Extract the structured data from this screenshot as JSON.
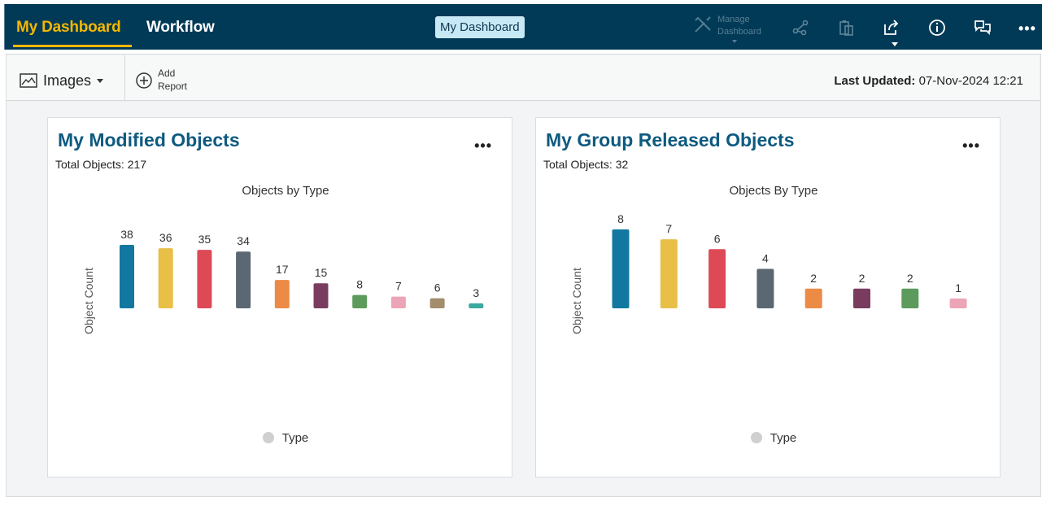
{
  "header": {
    "tabs": [
      {
        "label": "My Dashboard",
        "active": true
      },
      {
        "label": "Workflow",
        "active": false
      }
    ],
    "center_title": "My Dashboard",
    "manage_dashboard": {
      "line1": "Manage",
      "line2": "Dashboard"
    },
    "icons": [
      "manage-dashboard-icon",
      "flow-icon",
      "clipboard-icon",
      "share-icon",
      "info-icon",
      "chat-icon",
      "more-icon"
    ],
    "more_label": "•••"
  },
  "toolbar": {
    "images_label": "Images",
    "add_report": {
      "line1": "Add",
      "line2": "Report"
    },
    "last_updated_label": "Last Updated:",
    "last_updated_value": "07-Nov-2024 12:21"
  },
  "colors": {
    "topbar": "#013a57",
    "active_tab": "#f5b800",
    "title_blue": "#0e5a80",
    "palette": [
      "#12789f",
      "#e8bf47",
      "#dd4a55",
      "#5b6873",
      "#ec8b46",
      "#7a3c5e",
      "#5c9b5b",
      "#eca5b6",
      "#a38d6d",
      "#3aa8a0"
    ]
  },
  "cards": [
    {
      "title": "My Modified Objects",
      "subtitle": "Total Objects: 217",
      "more_label": "•••",
      "legend": "Type",
      "chart_data": {
        "type": "bar",
        "title": "Objects by Type",
        "xlabel": "",
        "ylabel": "Object Count",
        "legend": [
          "Type"
        ],
        "values": [
          38,
          36,
          35,
          34,
          17,
          15,
          8,
          7,
          6,
          3
        ],
        "ylim": [
          0,
          38
        ]
      }
    },
    {
      "title": "My Group Released Objects",
      "subtitle": "Total Objects: 32",
      "more_label": "•••",
      "legend": "Type",
      "chart_data": {
        "type": "bar",
        "title": "Objects By Type",
        "xlabel": "",
        "ylabel": "Object Count",
        "legend": [
          "Type"
        ],
        "values": [
          8,
          7,
          6,
          4,
          2,
          2,
          2,
          1
        ],
        "ylim": [
          0,
          8
        ]
      }
    }
  ]
}
